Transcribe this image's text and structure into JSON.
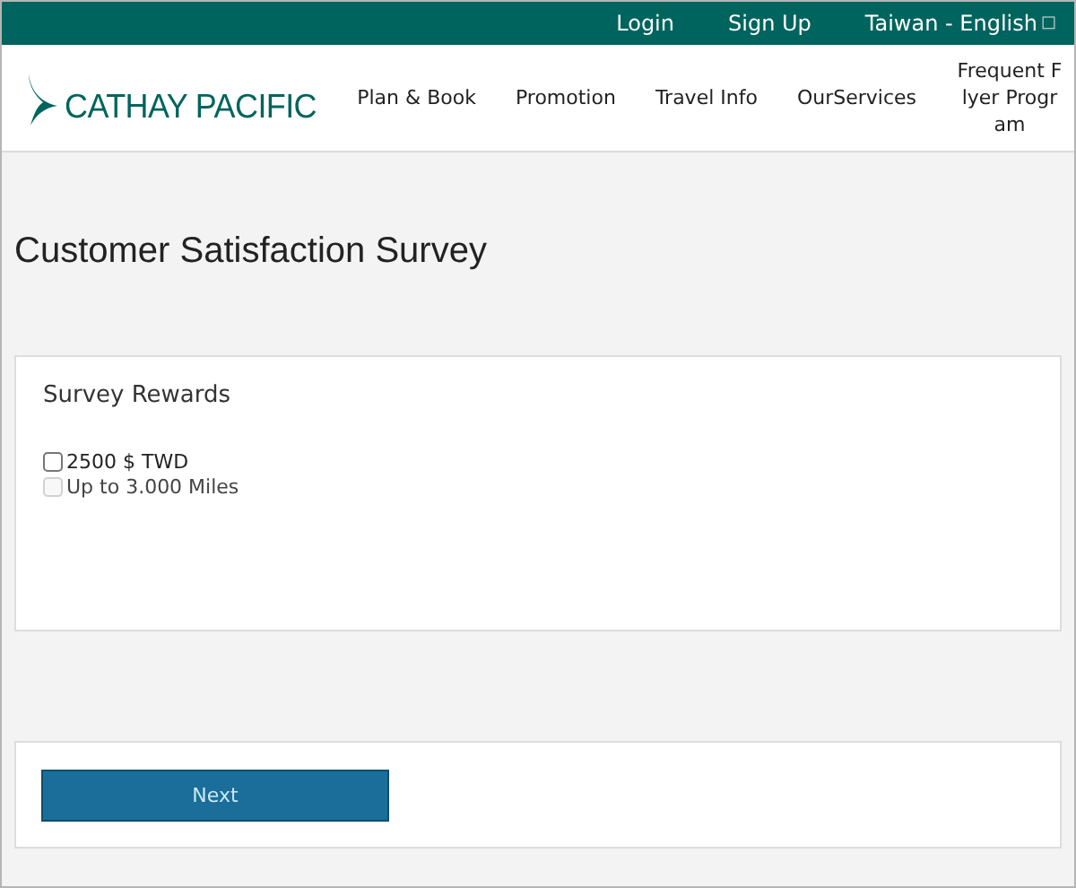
{
  "top_bar": {
    "links": [
      {
        "label": "Login"
      },
      {
        "label": "Sign Up"
      },
      {
        "label": "Taiwan - English",
        "icon_glyph": "□"
      }
    ]
  },
  "header": {
    "logo": "CATHAY PACIFIC",
    "nav": [
      {
        "label": "Plan & Book"
      },
      {
        "label": "Promotion"
      },
      {
        "label": "Travel Info"
      },
      {
        "label": "OurServices"
      },
      {
        "label": "Frequent Flyer Program"
      }
    ]
  },
  "page_title": "Customer Satisfaction Survey",
  "rewards": {
    "title": "Survey Rewards",
    "options": [
      {
        "label": "2500 $ TWD",
        "checked": false,
        "disabled": false
      },
      {
        "label": "Up to 3.000 Miles",
        "checked": false,
        "disabled": true
      }
    ]
  },
  "buttons": [
    {
      "label": "Next"
    }
  ]
}
